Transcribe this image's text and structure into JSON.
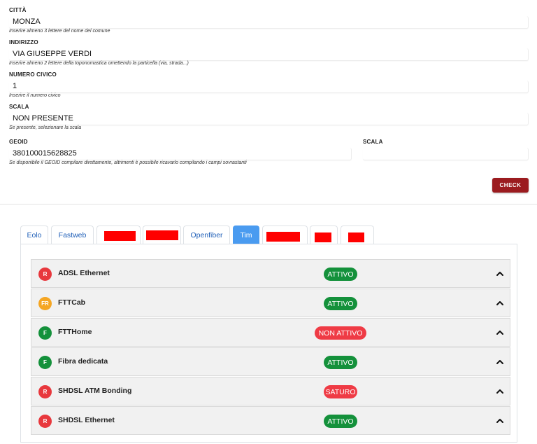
{
  "form": {
    "citta": {
      "label": "CITTÀ",
      "value": "MONZA",
      "hint": "Inserire almeno 3 lettere del nome del comune"
    },
    "indirizzo": {
      "label": "INDIRIZZO",
      "value": "VIA GIUSEPPE VERDI",
      "hint": "Inserire almeno 2 lettere della toponomastica omettendo la particella (via, strada...)"
    },
    "civico": {
      "label": "NUMERO CIVICO",
      "value": "1",
      "hint": "Inserire il numero civico"
    },
    "scala": {
      "label": "SCALA",
      "value": "NON PRESENTE",
      "hint": "Se presente, selezionare la scala"
    },
    "geoid": {
      "label": "GEOID",
      "value": "380100015628825",
      "hint": "Se disponibile il GEOID compilare direttamente, altrimenti è possibile ricavarlo compilando i campi sovrastanti"
    },
    "scala2": {
      "label": "SCALA",
      "value": ""
    },
    "check_label": "CHECK"
  },
  "tabs": [
    {
      "label": "Eolo"
    },
    {
      "label": "Fastweb"
    },
    {
      "label": ""
    },
    {
      "label": ""
    },
    {
      "label": "Openfiber"
    },
    {
      "label": "Tim",
      "active": true
    },
    {
      "label": ""
    },
    {
      "label": ""
    },
    {
      "label": ""
    }
  ],
  "services": [
    {
      "name": "ADSL Ethernet",
      "icon": "R",
      "icon_color": "#e8383d",
      "status": "ATTIVO",
      "status_color": "#14913b"
    },
    {
      "name": "FTTCab",
      "icon": "FR",
      "icon_color": "#f5a623",
      "status": "ATTIVO",
      "status_color": "#14913b"
    },
    {
      "name": "FTTHome",
      "icon": "F",
      "icon_color": "#14913b",
      "status": "NON ATTIVO",
      "status_color": "#ef3b45"
    },
    {
      "name": "Fibra dedicata",
      "icon": "F",
      "icon_color": "#14913b",
      "status": "ATTIVO",
      "status_color": "#14913b"
    },
    {
      "name": "SHDSL ATM Bonding",
      "icon": "R",
      "icon_color": "#e8383d",
      "status": "SATURO",
      "status_color": "#ef3b45"
    },
    {
      "name": "SHDSL Ethernet",
      "icon": "R",
      "icon_color": "#e8383d",
      "status": "ATTIVO",
      "status_color": "#14913b"
    }
  ]
}
